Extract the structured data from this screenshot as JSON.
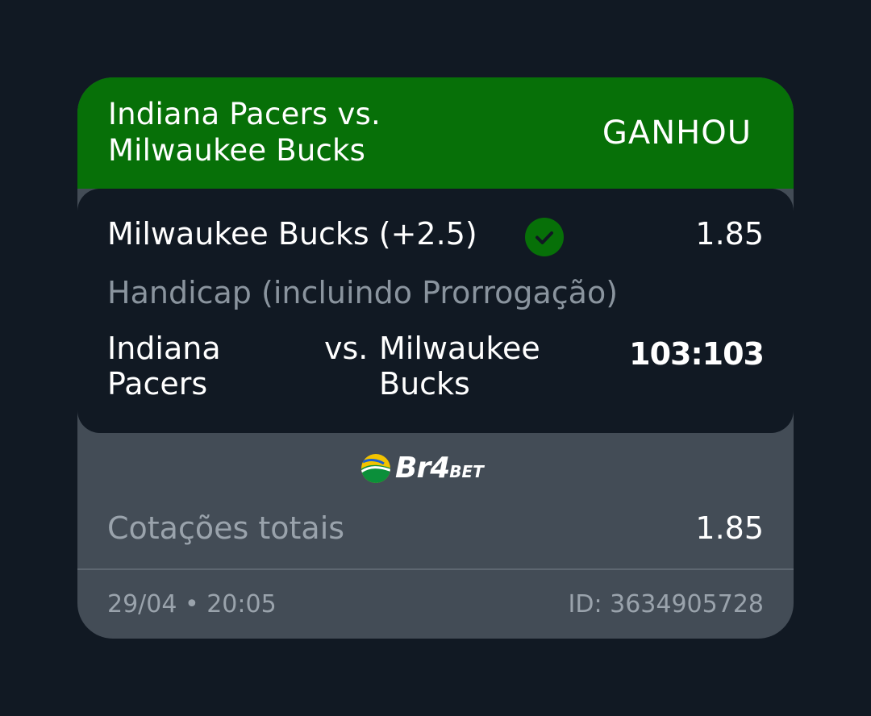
{
  "colors": {
    "background": "#111923",
    "card": "#434c56",
    "header": "#077008",
    "panel": "#111923",
    "accent_win": "#077008",
    "muted_text": "#8a949e"
  },
  "header": {
    "match_title": "Indiana Pacers vs. Milwaukee Bucks",
    "status": "GANHOU"
  },
  "bet": {
    "selection": "Milwaukee Bucks (+2.5)",
    "status_icon": "check-circle-icon",
    "odds": "1.85",
    "market": "Handicap (incluindo Prorrogação)",
    "home_team": "Indiana Pacers",
    "vs": "vs.",
    "away_team": "Milwaukee Bucks",
    "score": "103:103"
  },
  "brand": {
    "name": "Br4",
    "suffix": "BET",
    "icon": "ball-logo-icon"
  },
  "summary": {
    "total_label": "Cotações totais",
    "total_value": "1.85"
  },
  "footer": {
    "datetime": "29/04 • 20:05",
    "bet_id": "ID: 3634905728"
  }
}
